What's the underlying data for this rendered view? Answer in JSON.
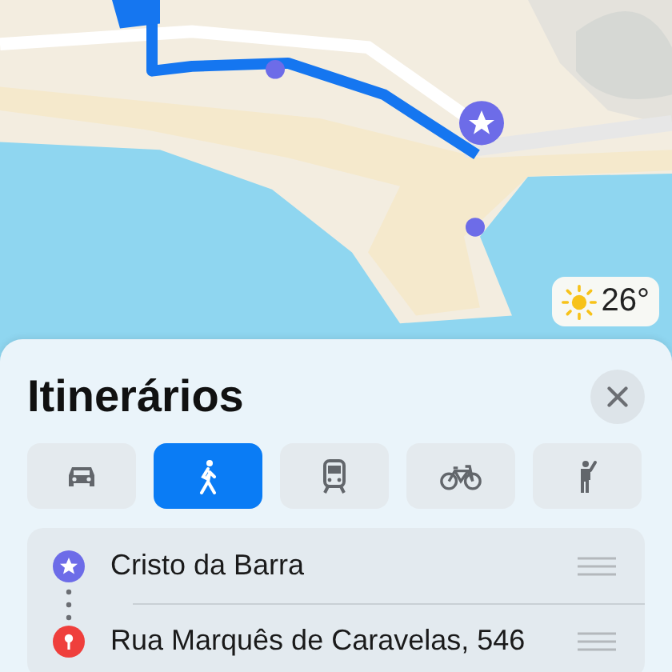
{
  "weather": {
    "temperature": "26°"
  },
  "sheet": {
    "title": "Itinerários"
  },
  "modes": [
    {
      "kind": "car",
      "selected": false
    },
    {
      "kind": "walk",
      "selected": true
    },
    {
      "kind": "transit",
      "selected": false
    },
    {
      "kind": "bike",
      "selected": false
    },
    {
      "kind": "rideshare",
      "selected": false
    }
  ],
  "stops": [
    {
      "kind": "origin",
      "name": "Cristo da Barra"
    },
    {
      "kind": "destination",
      "name": "Rua Marquês de Caravelas, 546"
    }
  ]
}
